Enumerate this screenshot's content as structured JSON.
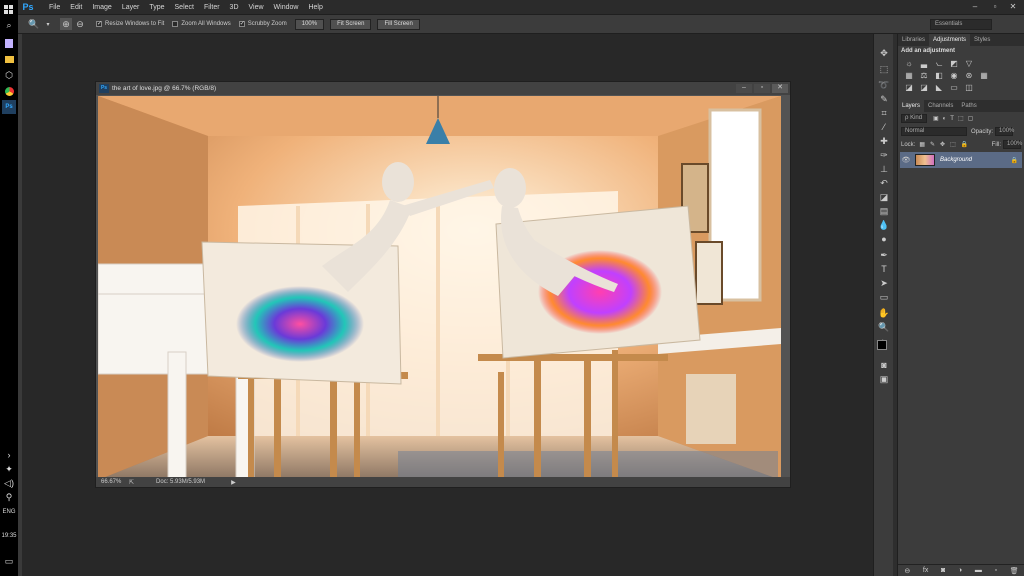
{
  "app": {
    "logo": "Ps"
  },
  "menu": [
    "File",
    "Edit",
    "Image",
    "Layer",
    "Type",
    "Select",
    "Filter",
    "3D",
    "View",
    "Window",
    "Help"
  ],
  "options": {
    "resize_windows": "Resize Windows to Fit",
    "zoom_all_windows": "Zoom All Windows",
    "scrubby_zoom": "Scrubby Zoom",
    "btn_100": "100%",
    "btn_fit": "Fit Screen",
    "btn_fill": "Fill Screen",
    "workspace": "Essentials"
  },
  "document": {
    "title": "the art of love.jpg @ 66.7% (RGB/8)",
    "zoom": "66.67%",
    "doc_size": "Doc: 5.93M/5.93M"
  },
  "taskbar": {
    "lang": "ENG",
    "time": "19:35"
  },
  "panels": {
    "top_tabs": [
      "Libraries",
      "Adjustments",
      "Styles"
    ],
    "adj_heading": "Add an adjustment",
    "layer_tabs": [
      "Layers",
      "Channels",
      "Paths"
    ],
    "kind": "ρ Kind",
    "blend": "Normal",
    "opacity_label": "Opacity:",
    "opacity_value": "100%",
    "lock_label": "Lock:",
    "fill_label": "Fill:",
    "fill_value": "100%",
    "layer_name": "Background"
  },
  "colors": {
    "accent": "#31a8ff",
    "layer_selected": "#5b6b86",
    "bg": "#282828"
  }
}
